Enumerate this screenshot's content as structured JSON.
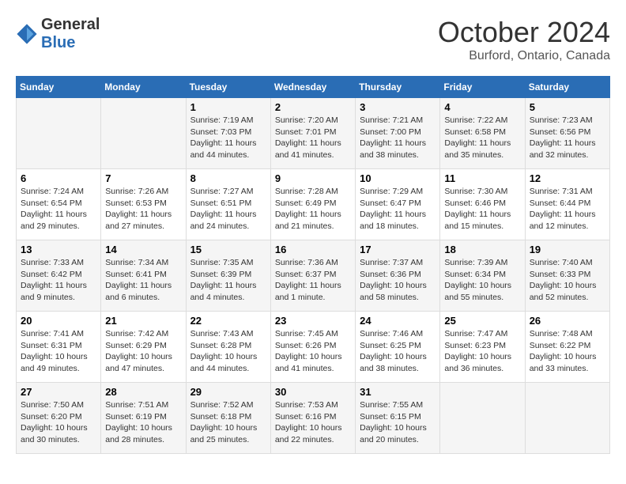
{
  "header": {
    "logo_general": "General",
    "logo_blue": "Blue",
    "month_year": "October 2024",
    "location": "Burford, Ontario, Canada"
  },
  "days_of_week": [
    "Sunday",
    "Monday",
    "Tuesday",
    "Wednesday",
    "Thursday",
    "Friday",
    "Saturday"
  ],
  "weeks": [
    [
      {
        "day": "",
        "info": ""
      },
      {
        "day": "",
        "info": ""
      },
      {
        "day": "1",
        "info": "Sunrise: 7:19 AM\nSunset: 7:03 PM\nDaylight: 11 hours and 44 minutes."
      },
      {
        "day": "2",
        "info": "Sunrise: 7:20 AM\nSunset: 7:01 PM\nDaylight: 11 hours and 41 minutes."
      },
      {
        "day": "3",
        "info": "Sunrise: 7:21 AM\nSunset: 7:00 PM\nDaylight: 11 hours and 38 minutes."
      },
      {
        "day": "4",
        "info": "Sunrise: 7:22 AM\nSunset: 6:58 PM\nDaylight: 11 hours and 35 minutes."
      },
      {
        "day": "5",
        "info": "Sunrise: 7:23 AM\nSunset: 6:56 PM\nDaylight: 11 hours and 32 minutes."
      }
    ],
    [
      {
        "day": "6",
        "info": "Sunrise: 7:24 AM\nSunset: 6:54 PM\nDaylight: 11 hours and 29 minutes."
      },
      {
        "day": "7",
        "info": "Sunrise: 7:26 AM\nSunset: 6:53 PM\nDaylight: 11 hours and 27 minutes."
      },
      {
        "day": "8",
        "info": "Sunrise: 7:27 AM\nSunset: 6:51 PM\nDaylight: 11 hours and 24 minutes."
      },
      {
        "day": "9",
        "info": "Sunrise: 7:28 AM\nSunset: 6:49 PM\nDaylight: 11 hours and 21 minutes."
      },
      {
        "day": "10",
        "info": "Sunrise: 7:29 AM\nSunset: 6:47 PM\nDaylight: 11 hours and 18 minutes."
      },
      {
        "day": "11",
        "info": "Sunrise: 7:30 AM\nSunset: 6:46 PM\nDaylight: 11 hours and 15 minutes."
      },
      {
        "day": "12",
        "info": "Sunrise: 7:31 AM\nSunset: 6:44 PM\nDaylight: 11 hours and 12 minutes."
      }
    ],
    [
      {
        "day": "13",
        "info": "Sunrise: 7:33 AM\nSunset: 6:42 PM\nDaylight: 11 hours and 9 minutes."
      },
      {
        "day": "14",
        "info": "Sunrise: 7:34 AM\nSunset: 6:41 PM\nDaylight: 11 hours and 6 minutes."
      },
      {
        "day": "15",
        "info": "Sunrise: 7:35 AM\nSunset: 6:39 PM\nDaylight: 11 hours and 4 minutes."
      },
      {
        "day": "16",
        "info": "Sunrise: 7:36 AM\nSunset: 6:37 PM\nDaylight: 11 hours and 1 minute."
      },
      {
        "day": "17",
        "info": "Sunrise: 7:37 AM\nSunset: 6:36 PM\nDaylight: 10 hours and 58 minutes."
      },
      {
        "day": "18",
        "info": "Sunrise: 7:39 AM\nSunset: 6:34 PM\nDaylight: 10 hours and 55 minutes."
      },
      {
        "day": "19",
        "info": "Sunrise: 7:40 AM\nSunset: 6:33 PM\nDaylight: 10 hours and 52 minutes."
      }
    ],
    [
      {
        "day": "20",
        "info": "Sunrise: 7:41 AM\nSunset: 6:31 PM\nDaylight: 10 hours and 49 minutes."
      },
      {
        "day": "21",
        "info": "Sunrise: 7:42 AM\nSunset: 6:29 PM\nDaylight: 10 hours and 47 minutes."
      },
      {
        "day": "22",
        "info": "Sunrise: 7:43 AM\nSunset: 6:28 PM\nDaylight: 10 hours and 44 minutes."
      },
      {
        "day": "23",
        "info": "Sunrise: 7:45 AM\nSunset: 6:26 PM\nDaylight: 10 hours and 41 minutes."
      },
      {
        "day": "24",
        "info": "Sunrise: 7:46 AM\nSunset: 6:25 PM\nDaylight: 10 hours and 38 minutes."
      },
      {
        "day": "25",
        "info": "Sunrise: 7:47 AM\nSunset: 6:23 PM\nDaylight: 10 hours and 36 minutes."
      },
      {
        "day": "26",
        "info": "Sunrise: 7:48 AM\nSunset: 6:22 PM\nDaylight: 10 hours and 33 minutes."
      }
    ],
    [
      {
        "day": "27",
        "info": "Sunrise: 7:50 AM\nSunset: 6:20 PM\nDaylight: 10 hours and 30 minutes."
      },
      {
        "day": "28",
        "info": "Sunrise: 7:51 AM\nSunset: 6:19 PM\nDaylight: 10 hours and 28 minutes."
      },
      {
        "day": "29",
        "info": "Sunrise: 7:52 AM\nSunset: 6:18 PM\nDaylight: 10 hours and 25 minutes."
      },
      {
        "day": "30",
        "info": "Sunrise: 7:53 AM\nSunset: 6:16 PM\nDaylight: 10 hours and 22 minutes."
      },
      {
        "day": "31",
        "info": "Sunrise: 7:55 AM\nSunset: 6:15 PM\nDaylight: 10 hours and 20 minutes."
      },
      {
        "day": "",
        "info": ""
      },
      {
        "day": "",
        "info": ""
      }
    ]
  ]
}
